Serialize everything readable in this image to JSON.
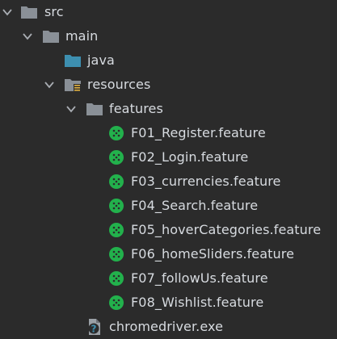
{
  "project_tree": {
    "items": [
      {
        "label": "src",
        "icon": "folder-icon",
        "expanded": true
      },
      {
        "label": "main",
        "icon": "folder-icon",
        "expanded": true
      },
      {
        "label": "java",
        "icon": "source-folder-icon"
      },
      {
        "label": "resources",
        "icon": "resources-folder-icon",
        "expanded": true
      },
      {
        "label": "features",
        "icon": "folder-icon",
        "expanded": true
      },
      {
        "label": "F01_Register.feature",
        "icon": "cucumber-feature-icon"
      },
      {
        "label": "F02_Login.feature",
        "icon": "cucumber-feature-icon"
      },
      {
        "label": "F03_currencies.feature",
        "icon": "cucumber-feature-icon"
      },
      {
        "label": "F04_Search.feature",
        "icon": "cucumber-feature-icon"
      },
      {
        "label": "F05_hoverCategories.feature",
        "icon": "cucumber-feature-icon"
      },
      {
        "label": "F06_homeSliders.feature",
        "icon": "cucumber-feature-icon"
      },
      {
        "label": "F07_followUs.feature",
        "icon": "cucumber-feature-icon"
      },
      {
        "label": "F08_Wishlist.feature",
        "icon": "cucumber-feature-icon"
      },
      {
        "label": "chromedriver.exe",
        "icon": "unknown-file-icon"
      }
    ]
  },
  "colors": {
    "background": "#2b2b2b",
    "text": "#d7dbe0",
    "folder": "#8a9097",
    "source_folder": "#3d8fb0",
    "cucumber": "#22b14c"
  }
}
